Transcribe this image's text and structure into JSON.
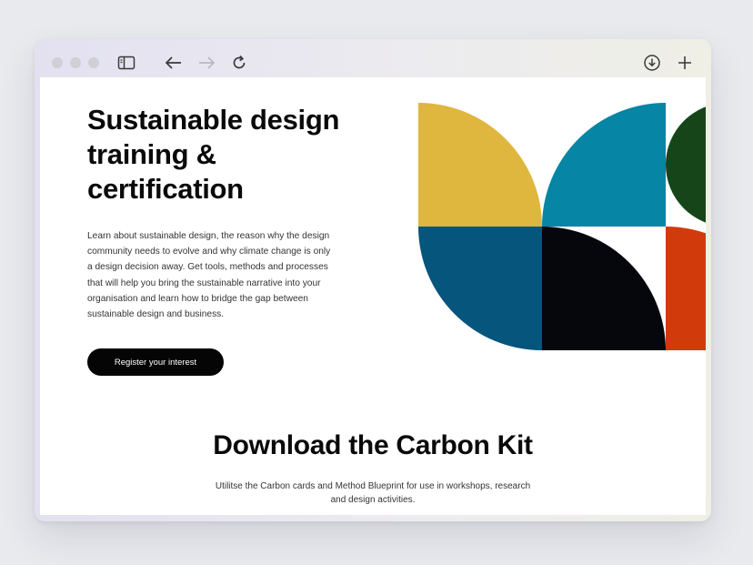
{
  "browser": {
    "icons": [
      "sidebar-icon",
      "back-arrow-icon",
      "forward-arrow-icon",
      "reload-icon",
      "download-icon",
      "new-tab-plus-icon"
    ],
    "colors": {
      "dot": "#cfcfd6",
      "icon": "#3a3a3a",
      "icon_disabled": "#b9b9c0"
    }
  },
  "hero": {
    "title": "Sustainable design training & certification",
    "body": "Learn about sustainable design, the reason why the design community needs to evolve and why climate change is only a design decision away. Get tools, methods and processes that will help you bring the sustainable narrative into your organisation and learn how to bridge the gap between sustainable design and business.",
    "cta_label": "Register your interest"
  },
  "art": {
    "colors": {
      "yellow": "#dfb63e",
      "teal": "#0785a4",
      "dark_green": "#16451a",
      "navy": "#05557d",
      "black": "#05070d",
      "orange": "#d13b0c"
    }
  },
  "carbon_kit": {
    "title": "Download the Carbon Kit",
    "body": "Utilitse the Carbon cards and Method Blueprint for use in workshops, research and design activities."
  }
}
